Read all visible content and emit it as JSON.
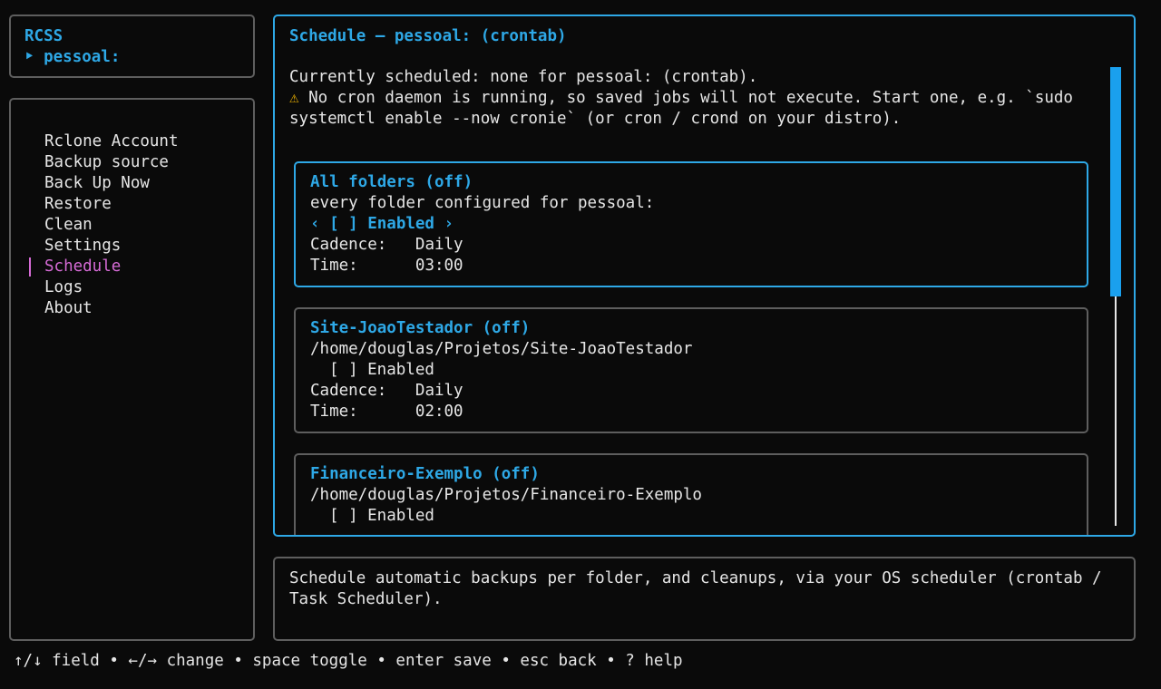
{
  "header": {
    "app_name": "RCSS",
    "profile_marker": "‣",
    "profile": "pessoal:"
  },
  "menu": {
    "items": [
      {
        "label": "Rclone Account"
      },
      {
        "label": "Backup source"
      },
      {
        "label": "Back Up Now"
      },
      {
        "label": "Restore"
      },
      {
        "label": "Clean"
      },
      {
        "label": "Settings"
      },
      {
        "label": "Schedule",
        "selected": true
      },
      {
        "label": "Logs"
      },
      {
        "label": "About"
      }
    ]
  },
  "main": {
    "title": "Schedule — pessoal: (crontab)",
    "status_line": "Currently scheduled: none for pessoal: (crontab).",
    "warning_icon": "warning-icon",
    "warning_symbol": "⚠",
    "warning_line1": "No cron daemon is running, so saved jobs will not execute. Start one, e.g. `sudo",
    "warning_line2": "systemctl enable --now cronie` (or cron / crond on your distro).",
    "cards": [
      {
        "title": "All folders (off)",
        "subtitle": "every folder configured for pessoal:",
        "toggle": "‹ [ ] Enabled ›",
        "cadence_label": "Cadence:",
        "cadence_value": "Daily",
        "time_label": "Time:",
        "time_value": "03:00"
      },
      {
        "title": "Site-JoaoTestador (off)",
        "subtitle": "/home/douglas/Projetos/Site-JoaoTestador",
        "toggle": "[ ] Enabled",
        "cadence_label": "Cadence:",
        "cadence_value": "Daily",
        "time_label": "Time:",
        "time_value": "02:00"
      },
      {
        "title": "Financeiro-Exemplo (off)",
        "subtitle": "/home/douglas/Projetos/Financeiro-Exemplo",
        "toggle": "[ ] Enabled"
      }
    ],
    "scroll_fraction_visible": 0.5
  },
  "help": {
    "line1": "Schedule automatic backups per folder, and cleanups, via your OS scheduler (crontab /",
    "line2": "Task Scheduler)."
  },
  "footer": {
    "keys": "↑/↓ field • ←/→ change • space toggle • enter save • esc back • ? help"
  },
  "colors": {
    "accent": "#2ea8e6",
    "selected": "#d66bd6",
    "warning": "#f0b400",
    "border": "#5e5e5e",
    "background": "#0a0a0a"
  }
}
